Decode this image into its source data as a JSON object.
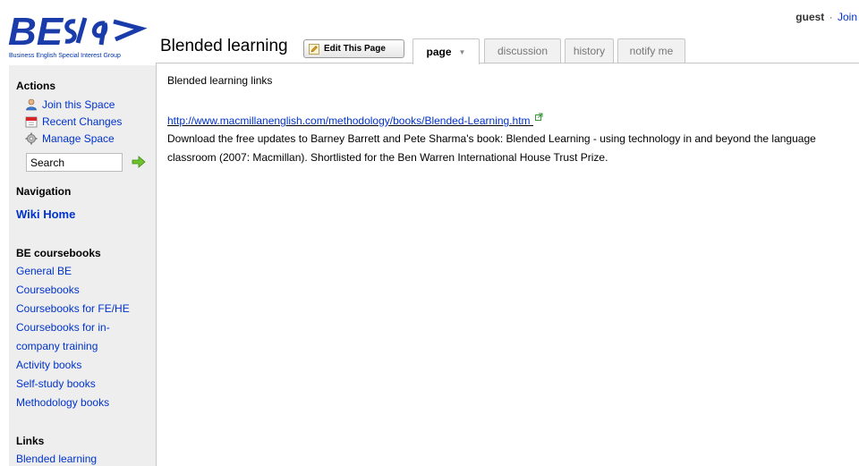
{
  "logo": {
    "mark": "BEsig",
    "subtitle": "Business English Special Interest Group"
  },
  "userbar": {
    "user": "guest",
    "separator": "·",
    "join": "Join"
  },
  "page": {
    "title": "Blended learning"
  },
  "toolbar": {
    "edit_label": "Edit This Page"
  },
  "tabs": [
    {
      "label": "page",
      "active": true
    },
    {
      "label": "discussion"
    },
    {
      "label": "history"
    },
    {
      "label": "notify me"
    }
  ],
  "sidebar": {
    "actions_heading": "Actions",
    "actions": [
      {
        "label": "Join this Space",
        "icon": "user-icon"
      },
      {
        "label": "Recent Changes",
        "icon": "calendar-icon"
      },
      {
        "label": "Manage Space",
        "icon": "gear-icon"
      }
    ],
    "search_value": "Search",
    "navigation_heading": "Navigation",
    "wiki_home": "Wiki Home",
    "coursebooks_heading": "BE coursebooks",
    "coursebooks": [
      "General BE",
      "Coursebooks",
      "Coursebooks for FE/HE",
      "Coursebooks for in-",
      "company training",
      "Activity books",
      "Self-study books",
      "Methodology books"
    ],
    "links_heading": "Links",
    "links": [
      "Blended learning"
    ]
  },
  "content": {
    "heading": "Blended learning links",
    "link": "http://www.macmillanenglish.com/methodology/books/Blended-Learning.htm",
    "text": "Download the free updates to Barney Barrett and Pete Sharma's book: Blended Learning - using technology in and beyond the language classroom (2007: Macmillan). Shortlisted for the Ben Warren International House Trust Prize."
  },
  "colors": {
    "link": "#0033cc",
    "sidebar_bg": "#eeeeee",
    "logo_blue": "#0033aa"
  }
}
